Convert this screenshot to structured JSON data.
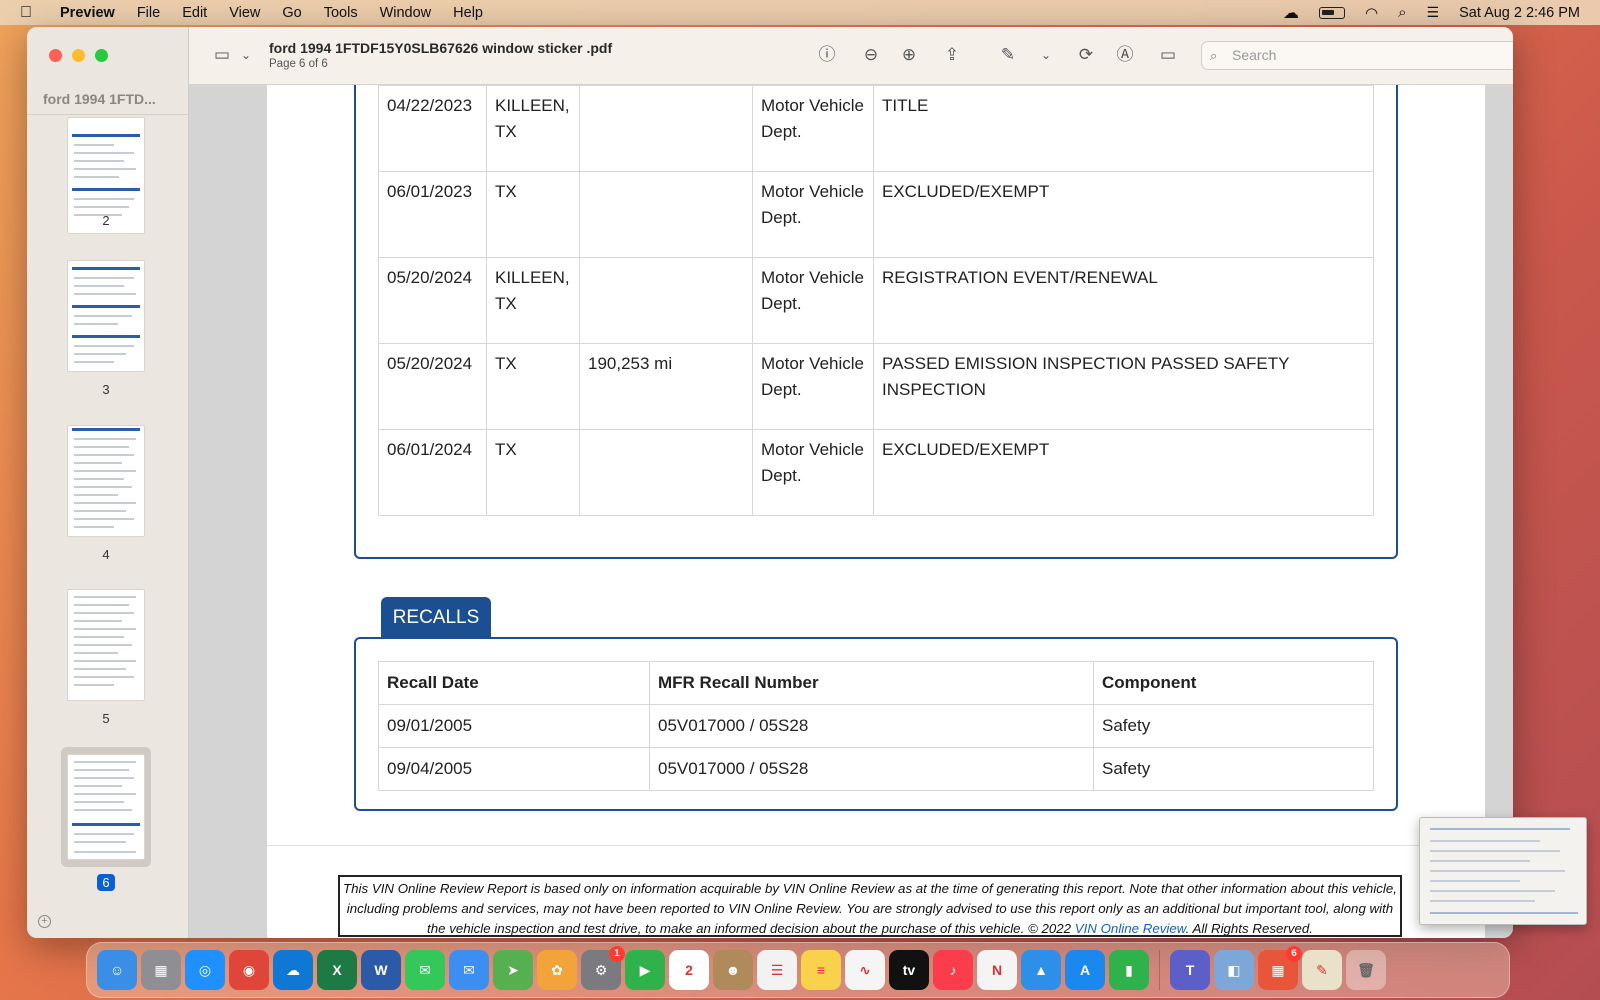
{
  "menubar": {
    "app_name": "Preview",
    "items": [
      "File",
      "Edit",
      "View",
      "Go",
      "Tools",
      "Window",
      "Help"
    ],
    "datetime": "Sat Aug 2  2:46 PM"
  },
  "window": {
    "doc_title": "ford 1994 1FTDF15Y0SLB67626 window sticker .pdf",
    "page_indicator": "Page 6 of 6",
    "sidebar_title": "ford 1994 1FTD...",
    "search_placeholder": "Search",
    "thumbnails": [
      {
        "label": "2"
      },
      {
        "label": "3"
      },
      {
        "label": "4"
      },
      {
        "label": "5"
      },
      {
        "label": "6",
        "selected": true
      }
    ]
  },
  "history": {
    "rows": [
      {
        "date": "04/22/2023",
        "location": "KILLEEN, TX",
        "odometer": "",
        "source": "Motor Vehicle Dept.",
        "details": "TITLE"
      },
      {
        "date": "06/01/2023",
        "location": "TX",
        "odometer": "",
        "source": "Motor Vehicle Dept.",
        "details": "EXCLUDED/EXEMPT"
      },
      {
        "date": "05/20/2024",
        "location": "KILLEEN, TX",
        "odometer": "",
        "source": "Motor Vehicle Dept.",
        "details": "REGISTRATION EVENT/RENEWAL"
      },
      {
        "date": "05/20/2024",
        "location": "TX",
        "odometer": "190,253 mi",
        "source": "Motor Vehicle Dept.",
        "details": "PASSED EMISSION INSPECTION PASSED SAFETY INSPECTION"
      },
      {
        "date": "06/01/2024",
        "location": "TX",
        "odometer": "",
        "source": "Motor Vehicle Dept.",
        "details": "EXCLUDED/EXEMPT"
      }
    ]
  },
  "recalls": {
    "tab_label": "RECALLS",
    "headers": [
      "Recall Date",
      "MFR Recall Number",
      "Component"
    ],
    "rows": [
      [
        "09/01/2005",
        "05V017000 / 05S28",
        "Safety"
      ],
      [
        "09/04/2005",
        "05V017000 / 05S28",
        "Safety"
      ]
    ]
  },
  "footer": {
    "text_before": "This VIN Online Review Report is based only on information acquirable by VIN Online Review as at the time of generating this report. Note that other information about this vehicle, including problems and services, may not have been reported to VIN Online Review. You are strongly advised to use this report only as an additional but important tool, along with the vehicle inspection and test drive, to make an informed decision about the purchase of this vehicle. © 2022 ",
    "link": "VIN Online Review",
    "text_after": ". All Rights Reserved."
  },
  "dock": {
    "apps": [
      {
        "name": "finder",
        "color": "#3a8ee6",
        "glyph": "☺"
      },
      {
        "name": "launchpad",
        "color": "#8e8e93",
        "glyph": "▦"
      },
      {
        "name": "safari",
        "color": "#1e90ff",
        "glyph": "◎"
      },
      {
        "name": "chrome",
        "color": "#e0453a",
        "glyph": "◉"
      },
      {
        "name": "onedrive",
        "color": "#0f78d4",
        "glyph": "☁"
      },
      {
        "name": "excel",
        "color": "#1d7a45",
        "glyph": "X"
      },
      {
        "name": "word",
        "color": "#2b5aa8",
        "glyph": "W"
      },
      {
        "name": "messages",
        "color": "#34c759",
        "glyph": "✉"
      },
      {
        "name": "mail",
        "color": "#3c8ff0",
        "glyph": "✉"
      },
      {
        "name": "maps",
        "color": "#56b04f",
        "glyph": "➤"
      },
      {
        "name": "photos",
        "color": "#f2a33a",
        "glyph": "✿"
      },
      {
        "name": "system-settings",
        "color": "#7a7a7f",
        "glyph": "⚙",
        "badge": "1"
      },
      {
        "name": "facetime",
        "color": "#2fb24c",
        "glyph": "▶"
      },
      {
        "name": "calendar",
        "color": "#ffffff",
        "glyph": "2"
      },
      {
        "name": "contacts",
        "color": "#b08a5a",
        "glyph": "☻"
      },
      {
        "name": "reminders",
        "color": "#f2f2f2",
        "glyph": "☰"
      },
      {
        "name": "notes",
        "color": "#f7d24a",
        "glyph": "≡"
      },
      {
        "name": "freeform",
        "color": "#f5f5f5",
        "glyph": "∿"
      },
      {
        "name": "apple-tv",
        "color": "#111111",
        "glyph": "tv"
      },
      {
        "name": "music",
        "color": "#fa3c4c",
        "glyph": "♪"
      },
      {
        "name": "news",
        "color": "#f4f4f4",
        "glyph": "N"
      },
      {
        "name": "keynote",
        "color": "#2d8fe8",
        "glyph": "▲"
      },
      {
        "name": "app-store",
        "color": "#1b88f0",
        "glyph": "A"
      },
      {
        "name": "numbers",
        "color": "#2fb24c",
        "glyph": "▮"
      },
      {
        "name": "teams",
        "color": "#5b5fc7",
        "glyph": "T"
      },
      {
        "name": "preview",
        "color": "#7da7d9",
        "glyph": "◧"
      },
      {
        "name": "office",
        "color": "#e8553a",
        "glyph": "▦",
        "badge": "6"
      },
      {
        "name": "textedit",
        "color": "#e9e1c8",
        "glyph": "✎"
      }
    ]
  }
}
